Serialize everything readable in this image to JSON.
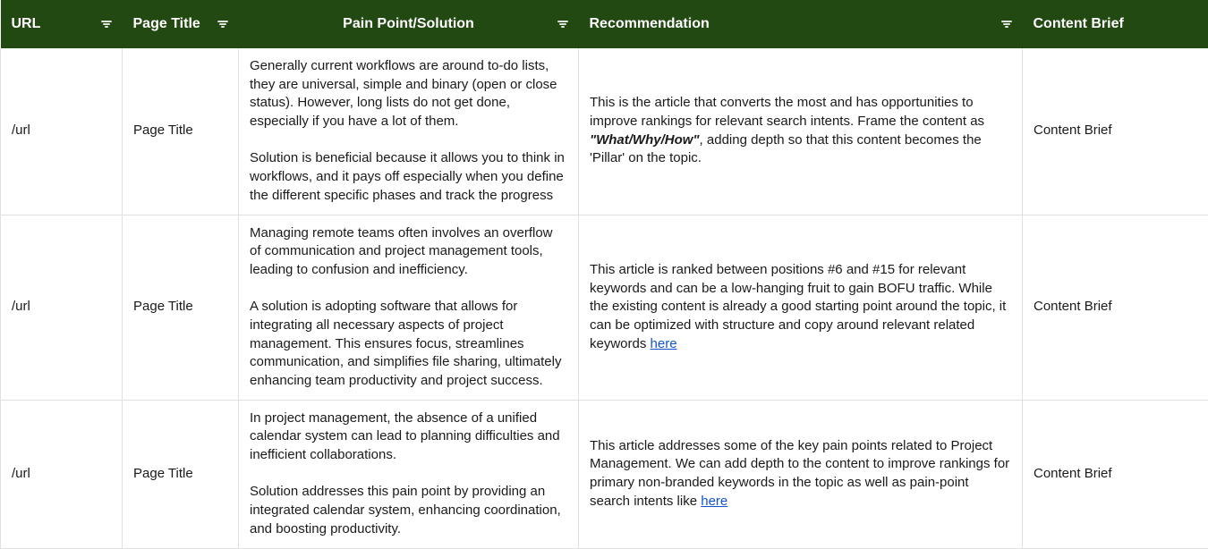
{
  "columns": {
    "url": "URL",
    "page_title": "Page Title",
    "pain_point_solution": "Pain Point/Solution",
    "recommendation": "Recommendation",
    "content_brief": "Content Brief"
  },
  "rows": [
    {
      "url": "/url",
      "page_title": "Page Title",
      "pain_point_solution": "Generally current workflows are around to-do lists, they are universal, simple and binary (open or close status). However, long lists do not get done, especially if you have a lot of them.\n\nSolution is beneficial because it allows you to think in workflows, and it pays off especially when you define the different specific phases and track the progress",
      "recommendation_pre": "This is the article that converts the most and has opportunities to improve rankings for relevant search intents. Frame the content as ",
      "recommendation_emph": "\"What/Why/How\"",
      "recommendation_post": ", adding depth so that this content becomes the 'Pillar' on the topic.",
      "recommendation_link": "",
      "content_brief": "Content Brief"
    },
    {
      "url": "/url",
      "page_title": "Page Title",
      "pain_point_solution": "Managing remote teams often involves an overflow of communication and project management tools, leading to confusion and inefficiency.\n\nA solution is adopting software that allows for integrating all necessary aspects of project management. This ensures focus, streamlines communication, and simplifies file sharing, ultimately enhancing team productivity and project success.",
      "recommendation_pre": "This article is ranked between positions #6 and #15 for relevant keywords and can be a low-hanging fruit to gain BOFU traffic. While the existing content is already a good starting point around the topic, it can be optimized with structure and copy around relevant related keywords ",
      "recommendation_emph": "",
      "recommendation_post": "",
      "recommendation_link": "here",
      "content_brief": "Content Brief"
    },
    {
      "url": "/url",
      "page_title": "Page Title",
      "pain_point_solution": "In project management, the absence of a unified calendar system can lead to planning difficulties and inefficient collaborations.\n\nSolution addresses this pain point by providing an integrated calendar system, enhancing coordination, and boosting productivity.",
      "recommendation_pre": "This article addresses some of the key pain points related to Project Management. We can add depth to the content to improve rankings for primary non-branded keywords in the topic as well as pain-point search intents like ",
      "recommendation_emph": "",
      "recommendation_post": "",
      "recommendation_link": "here",
      "content_brief": "Content Brief"
    }
  ]
}
